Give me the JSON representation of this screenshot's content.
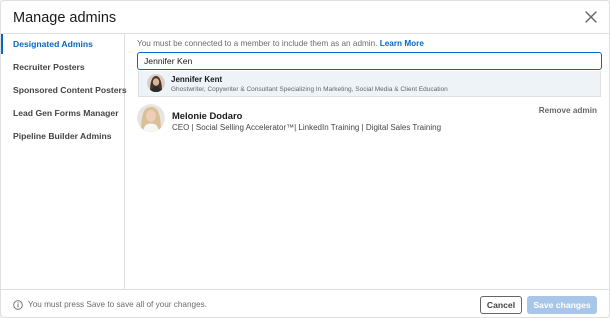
{
  "modal": {
    "title": "Manage admins",
    "close_icon": "close-icon"
  },
  "sidebar": {
    "items": [
      {
        "label": "Designated Admins",
        "active": true
      },
      {
        "label": "Recruiter Posters",
        "active": false
      },
      {
        "label": "Sponsored Content Posters",
        "active": false
      },
      {
        "label": "Lead Gen Forms Manager",
        "active": false
      },
      {
        "label": "Pipeline Builder Admins",
        "active": false
      }
    ]
  },
  "content": {
    "info_text": "You must be connected to a member to include them as an admin.",
    "learn_more_label": "Learn More",
    "search": {
      "value": "Jennifer Ken"
    },
    "suggestion": {
      "name": "Jennifer Kent",
      "headline": "Ghostwriter, Copywriter & Consultant Specializing In Marketing, Social Media & Client Education"
    },
    "admins": [
      {
        "name": "Melonie Dodaro",
        "headline": "CEO | Social Selling Accelerator™| LinkedIn Training | Digital Sales Training",
        "action_label": "Remove admin"
      }
    ]
  },
  "footer": {
    "info_icon": "info-icon",
    "note": "You must press Save to save all of your changes.",
    "cancel_label": "Cancel",
    "save_label": "Save changes"
  },
  "colors": {
    "accent": "#0a66c2",
    "save_disabled": "#a8c6e8",
    "dropdown_highlight": "#eef3f8"
  }
}
